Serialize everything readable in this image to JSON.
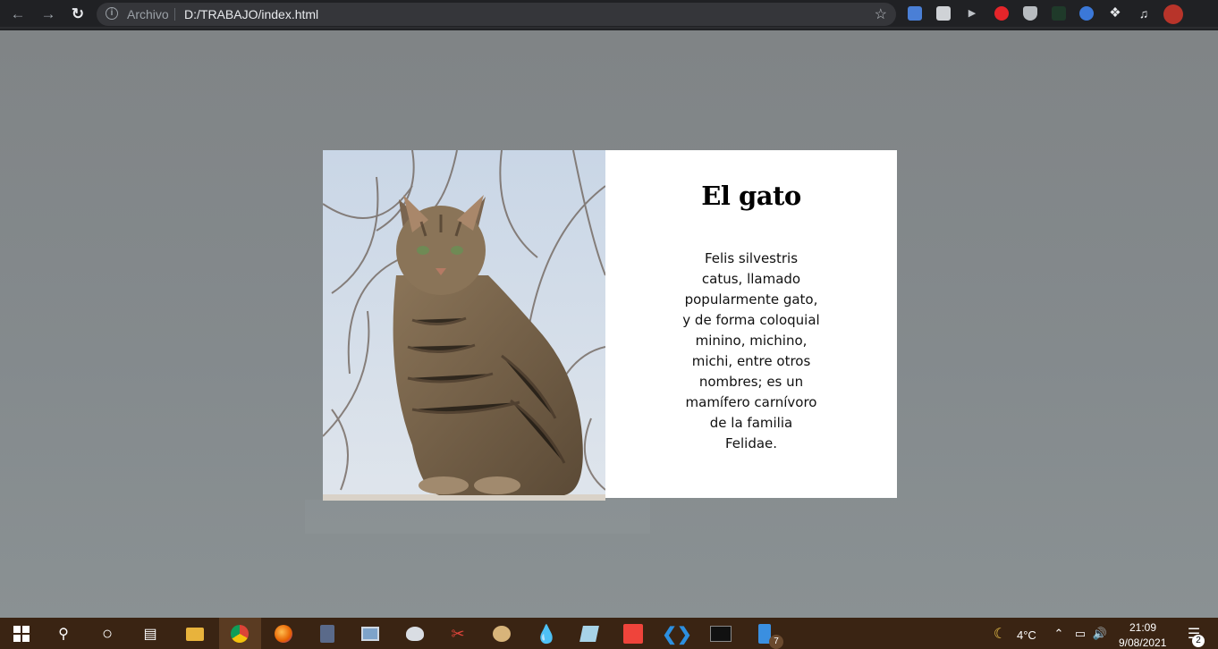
{
  "browser": {
    "archivo": "Archivo",
    "url": "D:/TRABAJO/index.html",
    "icons": [
      "back-arrow-icon",
      "forward-arrow-icon",
      "reload-icon",
      "info-icon",
      "star-icon",
      "puzzle-icon",
      "media-icon",
      "profile-avatar-icon"
    ]
  },
  "card": {
    "title": "El gato",
    "description_lines": [
      "Felis silvestris",
      "catus, llamado",
      "popularmente gato,",
      "y de forma coloquial",
      "minino, michino,",
      "michi, entre otros",
      "nombres; es un",
      "mamífero carnívoro",
      "de la familia",
      "Felidae."
    ]
  },
  "taskbar": {
    "temperature": "4°C",
    "time": "21:09",
    "date": "9/08/2021",
    "notifications": "2",
    "badge": "7",
    "colors": {
      "bar": "#3a2413",
      "active": "#5a3b22"
    }
  }
}
